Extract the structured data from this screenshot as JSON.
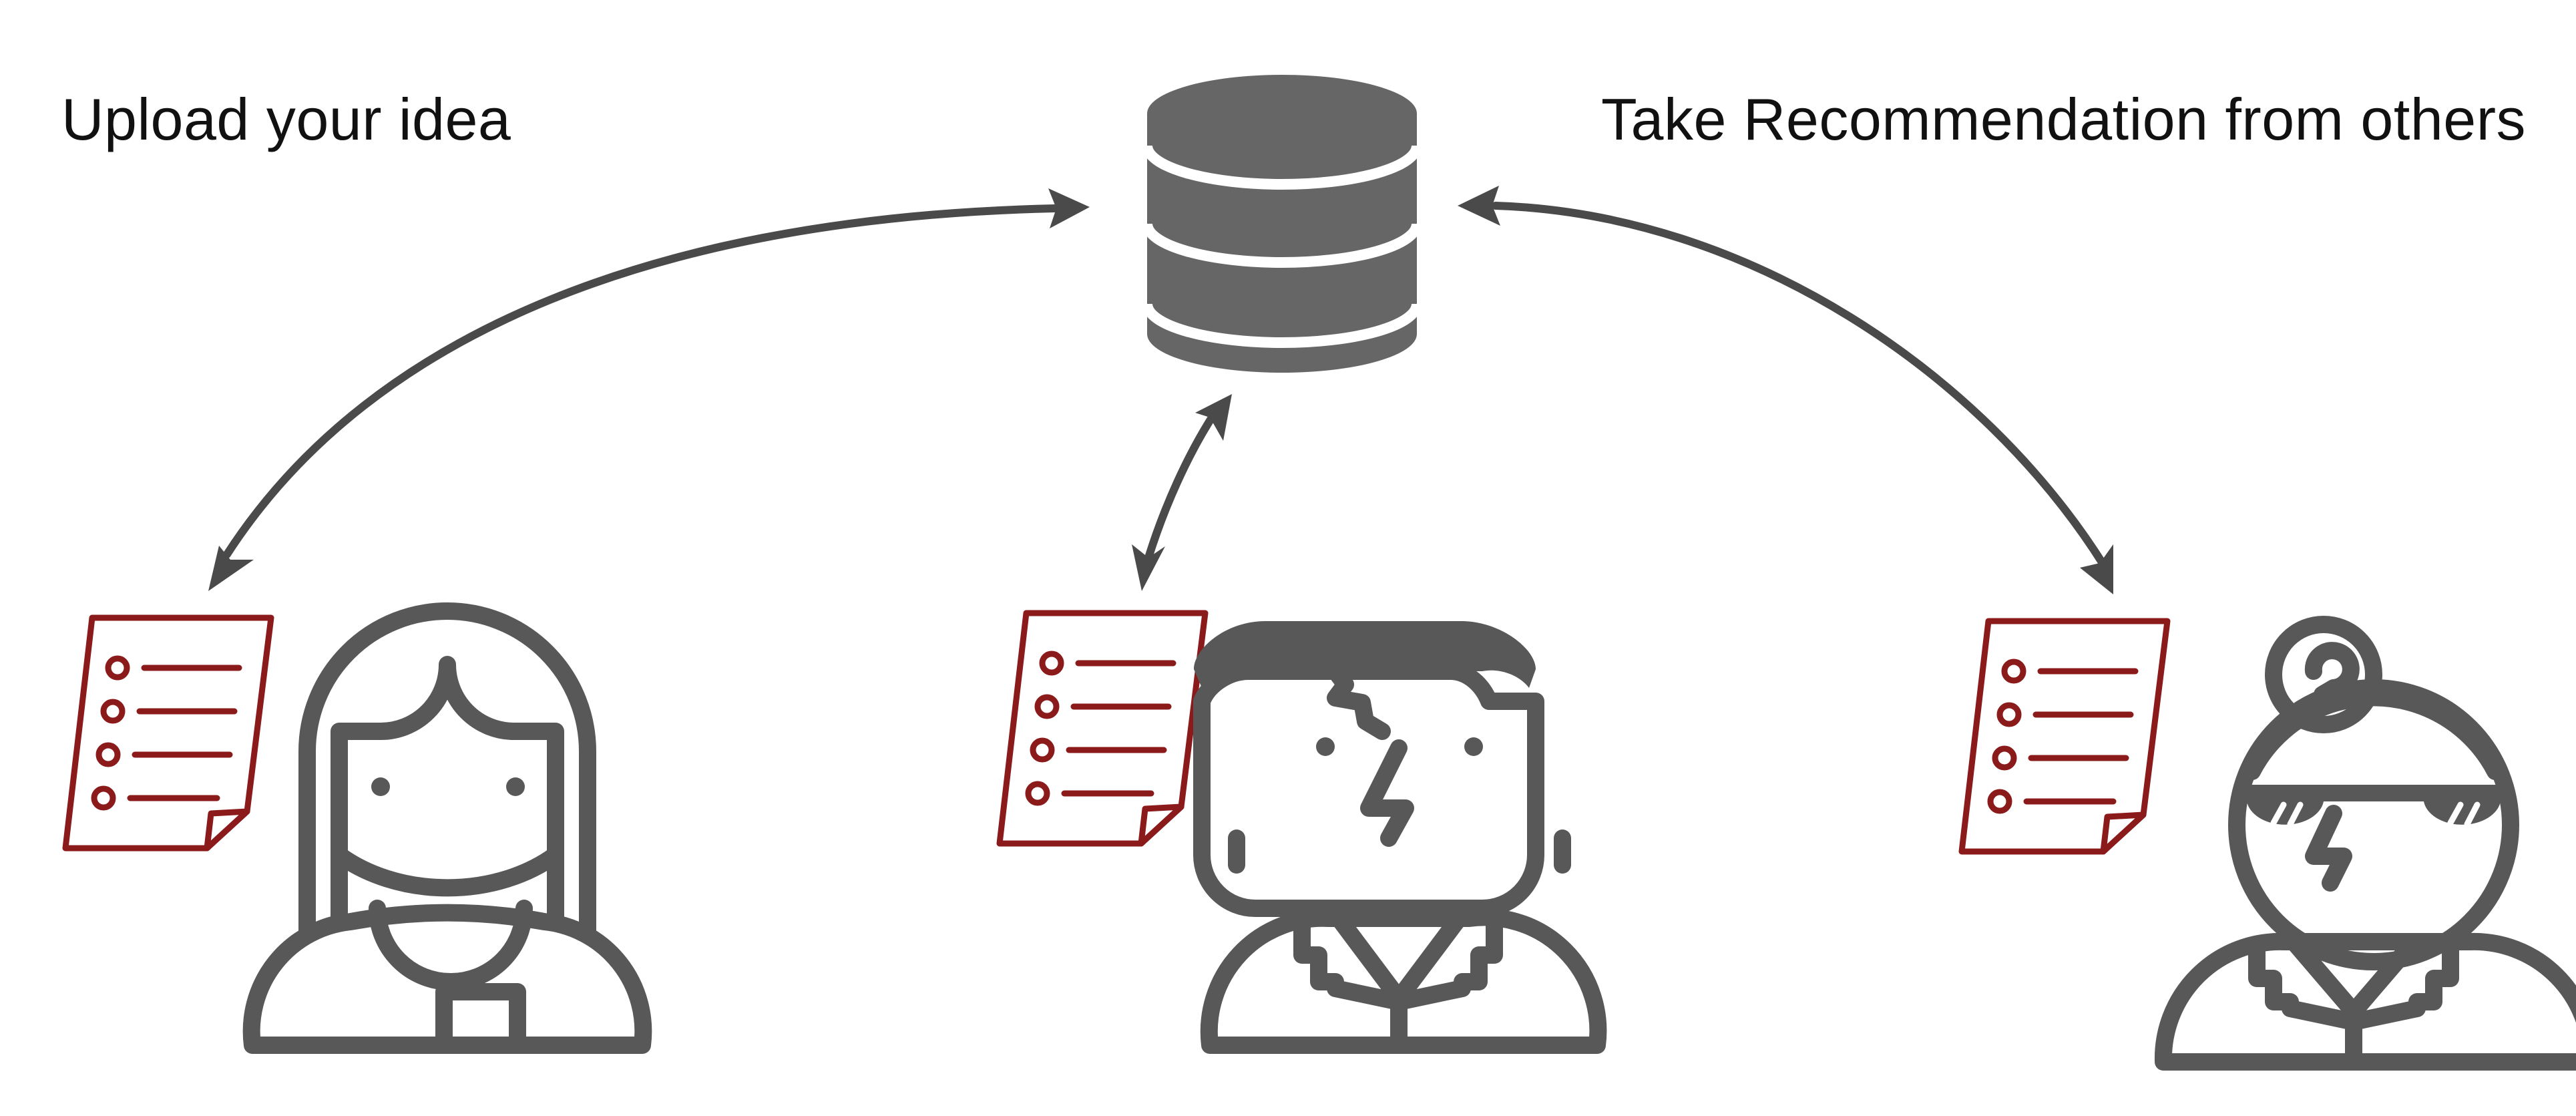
{
  "captions": {
    "upload": "Upload your idea",
    "recommend": "Take Recommendation from others"
  },
  "colors": {
    "icon": "#585858",
    "arrow": "#4a4a4a",
    "document": "#8b1a1a",
    "background": "#ffffff"
  },
  "icons": {
    "database": "database-icon",
    "left_person": "woman-user-icon",
    "center_person": "man-user-icon",
    "right_person": "woman-bun-user-icon",
    "document": "list-document-icon"
  }
}
